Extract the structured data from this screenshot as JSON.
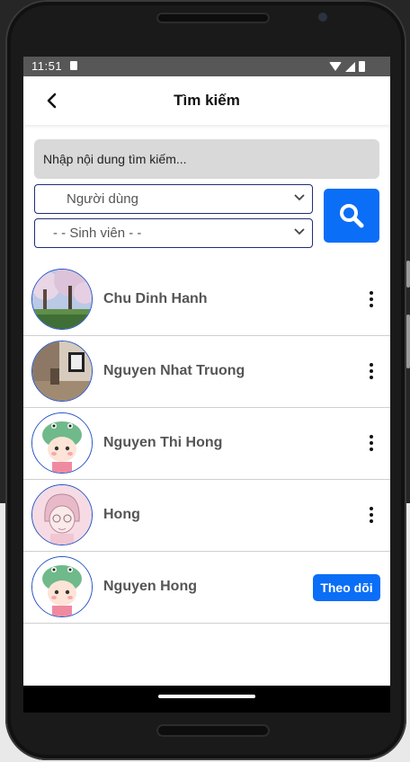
{
  "status_bar": {
    "time": "11:51"
  },
  "header": {
    "title": "Tìm kiếm"
  },
  "search": {
    "placeholder": "Nhập nội dung tìm kiếm...",
    "value": ""
  },
  "filters": {
    "user_type": "Người dùng",
    "role": "- - Sinh viên - -"
  },
  "results": [
    {
      "name": "Chu Dinh Hanh",
      "avatar": "cherry-blossom-photo",
      "action": "more"
    },
    {
      "name": "Nguyen Nhat Truong",
      "avatar": "room-photo",
      "action": "more"
    },
    {
      "name": "Nguyen Thi Hong",
      "avatar": "dino-hat-girl",
      "action": "more"
    },
    {
      "name": "Hong",
      "avatar": "sketch-girl",
      "action": "more"
    },
    {
      "name": "Nguyen Hong",
      "avatar": "dino-hat-girl",
      "action": "follow",
      "action_label": "Theo dõi"
    }
  ],
  "colors": {
    "accent": "#0b6ef7",
    "select_border": "#1f2d7a",
    "avatar_border": "#2352c8",
    "input_bg": "#d9d9d9",
    "status_bar_bg": "#575757"
  },
  "icons": {
    "back": "chevron-left-icon",
    "search": "search-icon",
    "dropdown": "chevron-down-icon",
    "more": "more-vertical-icon"
  }
}
